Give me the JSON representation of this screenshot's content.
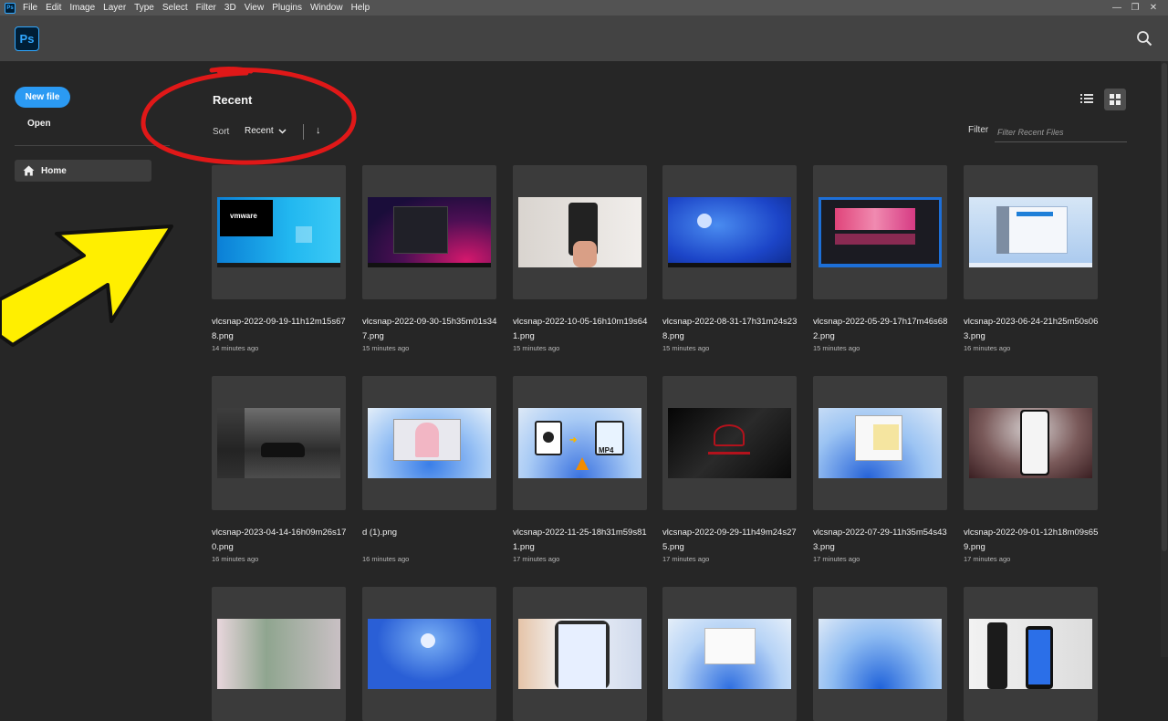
{
  "menubar": {
    "items": [
      "File",
      "Edit",
      "Image",
      "Layer",
      "Type",
      "Select",
      "Filter",
      "3D",
      "View",
      "Plugins",
      "Window",
      "Help"
    ],
    "window_controls": [
      "—",
      "❐",
      "✕"
    ]
  },
  "app": {
    "logo_text": "Ps",
    "logo_mini": "Ps"
  },
  "sidebar": {
    "new_file_label": "New file",
    "open_label": "Open",
    "home_label": "Home"
  },
  "main": {
    "title": "Recent",
    "sort_label": "Sort",
    "sort_value": "Recent",
    "sort_direction": "↓",
    "filter_label": "Filter",
    "filter_placeholder": "Filter Recent Files"
  },
  "files": [
    {
      "name": "vlcsnap-2022-09-19-11h12m15s678.png",
      "time": "14 minutes ago"
    },
    {
      "name": "vlcsnap-2022-09-30-15h35m01s347.png",
      "time": "15 minutes ago"
    },
    {
      "name": "vlcsnap-2022-10-05-16h10m19s641.png",
      "time": "15 minutes ago"
    },
    {
      "name": "vlcsnap-2022-08-31-17h31m24s238.png",
      "time": "15 minutes ago"
    },
    {
      "name": "vlcsnap-2022-05-29-17h17m46s682.png",
      "time": "15 minutes ago"
    },
    {
      "name": "vlcsnap-2023-06-24-21h25m50s063.png",
      "time": "16 minutes ago"
    },
    {
      "name": "vlcsnap-2023-04-14-16h09m26s170.png",
      "time": "16 minutes ago"
    },
    {
      "name": "d (1).png",
      "time": "16 minutes ago"
    },
    {
      "name": "vlcsnap-2022-11-25-18h31m59s811.png",
      "time": "17 minutes ago"
    },
    {
      "name": "vlcsnap-2022-09-29-11h49m24s275.png",
      "time": "17 minutes ago"
    },
    {
      "name": "vlcsnap-2022-07-29-11h35m54s433.png",
      "time": "17 minutes ago"
    },
    {
      "name": "vlcsnap-2022-09-01-12h18m09s659.png",
      "time": "17 minutes ago"
    },
    {
      "name": "",
      "time": ""
    },
    {
      "name": "",
      "time": ""
    },
    {
      "name": "",
      "time": ""
    },
    {
      "name": "",
      "time": ""
    },
    {
      "name": "",
      "time": ""
    },
    {
      "name": "",
      "time": ""
    }
  ],
  "thumb_texts": {
    "vmware": "vmware",
    "mp4": "MP4"
  }
}
